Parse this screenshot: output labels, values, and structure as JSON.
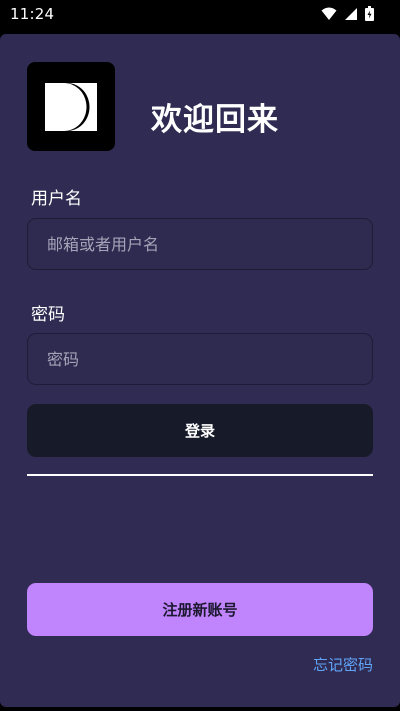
{
  "status_bar": {
    "time": "11:24",
    "icons": [
      "wifi-icon",
      "cellular-signal-icon",
      "battery-icon"
    ]
  },
  "header": {
    "logo_icon": "dual-half-circle-logo",
    "title": "欢迎回来"
  },
  "form": {
    "username_label": "用户名",
    "username_placeholder": "邮箱或者用户名",
    "username_value": "",
    "password_label": "密码",
    "password_placeholder": "密码",
    "password_value": "",
    "login_label": "登录"
  },
  "footer": {
    "register_label": "注册新账号",
    "forgot_label": "忘记密码"
  },
  "colors": {
    "card_background": "#302b52",
    "input_background": "#2f2a4f",
    "login_button": "#171a29",
    "register_button": "#c084fc",
    "link": "#60a5fa"
  }
}
